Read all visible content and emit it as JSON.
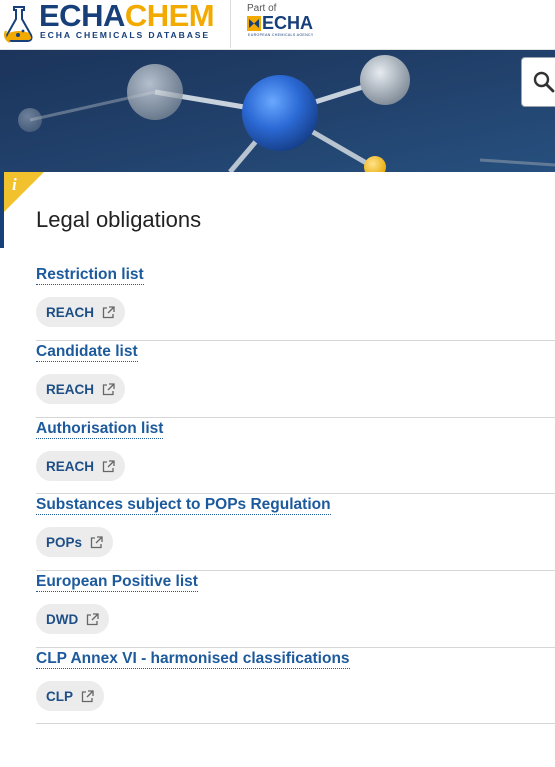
{
  "header": {
    "brand_part1": "ECHA",
    "brand_part2": "CHEM",
    "brand_subtitle": "ECHA CHEMICALS DATABASE",
    "part_of": "Part of",
    "echa_word": "ECHA",
    "echa_subtitle": "EUROPEAN CHEMICALS AGENCY"
  },
  "colors": {
    "brand_blue": "#173f7a",
    "brand_yellow": "#f2a900",
    "link_blue": "#1d5a9c",
    "pill_bg": "#ececec"
  },
  "page": {
    "title": "Legal obligations"
  },
  "obligations": [
    {
      "label": "Restriction list",
      "tag": "REACH"
    },
    {
      "label": "Candidate list",
      "tag": "REACH"
    },
    {
      "label": "Authorisation list",
      "tag": "REACH"
    },
    {
      "label": "Substances subject to POPs Regulation",
      "tag": "POPs"
    },
    {
      "label": "European Positive list",
      "tag": "DWD"
    },
    {
      "label": "CLP Annex VI - harmonised classifications",
      "tag": "CLP"
    }
  ],
  "icons": {
    "search": "search-icon",
    "info": "info-icon",
    "external": "external-link-icon"
  }
}
